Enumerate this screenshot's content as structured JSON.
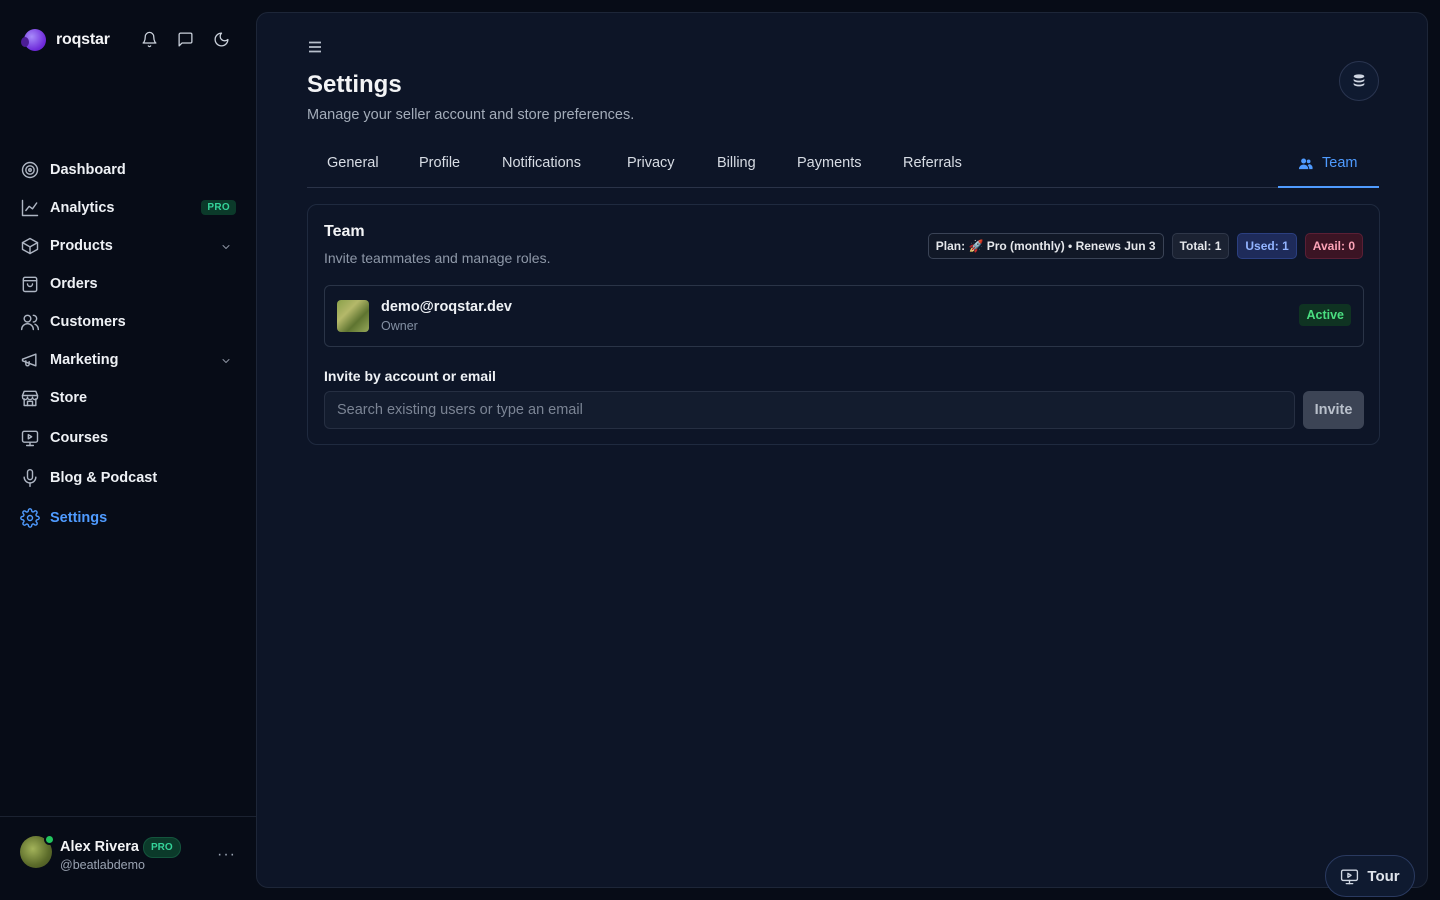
{
  "brand": {
    "name": "roqstar"
  },
  "sidebar": {
    "items": [
      {
        "label": "Dashboard",
        "icon": "dashboard-icon"
      },
      {
        "label": "Analytics",
        "icon": "analytics-icon",
        "badge": "PRO"
      },
      {
        "label": "Products",
        "icon": "products-icon",
        "expandable": true
      },
      {
        "label": "Orders",
        "icon": "orders-icon"
      },
      {
        "label": "Customers",
        "icon": "customers-icon"
      },
      {
        "label": "Marketing",
        "icon": "marketing-icon",
        "expandable": true
      },
      {
        "label": "Store",
        "icon": "store-icon"
      },
      {
        "label": "Courses",
        "icon": "courses-icon"
      },
      {
        "label": "Blog & Podcast",
        "icon": "microphone-icon"
      },
      {
        "label": "Settings",
        "icon": "gear-icon",
        "active": true
      }
    ],
    "user": {
      "name": "Alex Rivera",
      "badge": "PRO",
      "handle": "@beatlabdemo",
      "more": "···"
    }
  },
  "header": {
    "title": "Settings",
    "subtitle": "Manage your seller account and store preferences."
  },
  "tabs": [
    {
      "label": "General"
    },
    {
      "label": "Profile"
    },
    {
      "label": "Notifications"
    },
    {
      "label": "Privacy"
    },
    {
      "label": "Billing"
    },
    {
      "label": "Payments"
    },
    {
      "label": "Referrals"
    },
    {
      "label": "Team",
      "active": true
    }
  ],
  "team": {
    "title": "Team",
    "subtitle": "Invite teammates and manage roles.",
    "chips": {
      "plan": "Plan: 🚀 Pro (monthly) • Renews Jun 3",
      "total": "Total: 1",
      "used": "Used: 1",
      "avail": "Avail: 0"
    },
    "members": [
      {
        "email": "demo@roqstar.dev",
        "role": "Owner",
        "status": "Active"
      }
    ],
    "invite": {
      "label": "Invite by account or email",
      "value": "",
      "placeholder": "Search existing users or type an email",
      "button": "Invite"
    }
  },
  "tour": {
    "label": "Tour"
  },
  "colors": {
    "accent": "#4f9bff",
    "background": "#070c17",
    "panel": "#0d1527",
    "status_active": "#4ade80"
  }
}
